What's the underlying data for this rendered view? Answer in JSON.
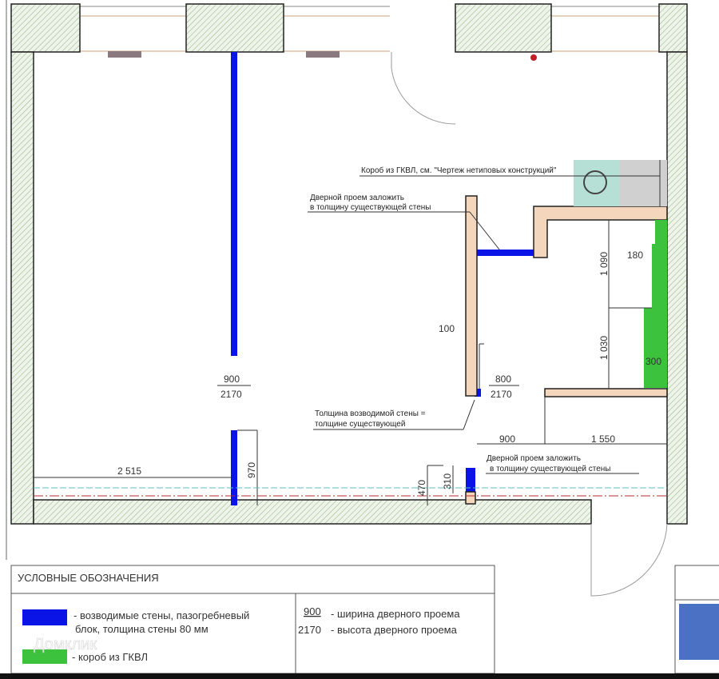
{
  "plan": {
    "notes": {
      "box_gkvl": "Короб из ГКВЛ, см. \"Чертеж нетиповых конструкций\"",
      "door_close_top_1": "Дверной проем заложить",
      "door_close_top_2": "в толщину существующей стены",
      "wall_thickness_1": "Толщина возводимой стены =",
      "wall_thickness_2": "толщине существующей",
      "door_close_bottom_1": "Дверной проем заложить",
      "door_close_bottom_2": "в толщину существующей стены"
    },
    "dimensions": {
      "door1_width": "900",
      "door1_height": "2170",
      "door2_width": "800",
      "door2_height": "2170",
      "d100": "100",
      "d1090": "1 090",
      "d180": "180",
      "d1030": "1 030",
      "d300": "300",
      "d900": "900",
      "d1550": "1 550",
      "d2515": "2 515",
      "d970": "970",
      "d470": "470",
      "d310": "310"
    }
  },
  "legend": {
    "title": "УСЛОВНЫЕ ОБОЗНАЧЕНИЯ",
    "blue_line1": "- возводимые стены, пазогребневый",
    "blue_line2": "блок, толщина стены 80 мм",
    "green": "- короб из ГКВЛ",
    "width_value": "900",
    "width_label": "- ширина дверного проема",
    "height_value": "2170",
    "height_label": "- высота дверного проема"
  },
  "watermark": "Домклик",
  "colors": {
    "new_wall": "#0a14e6",
    "gkvl": "#3cc23c",
    "existing_wall": "#f4d6bd",
    "hatch": "#e6efe0"
  }
}
